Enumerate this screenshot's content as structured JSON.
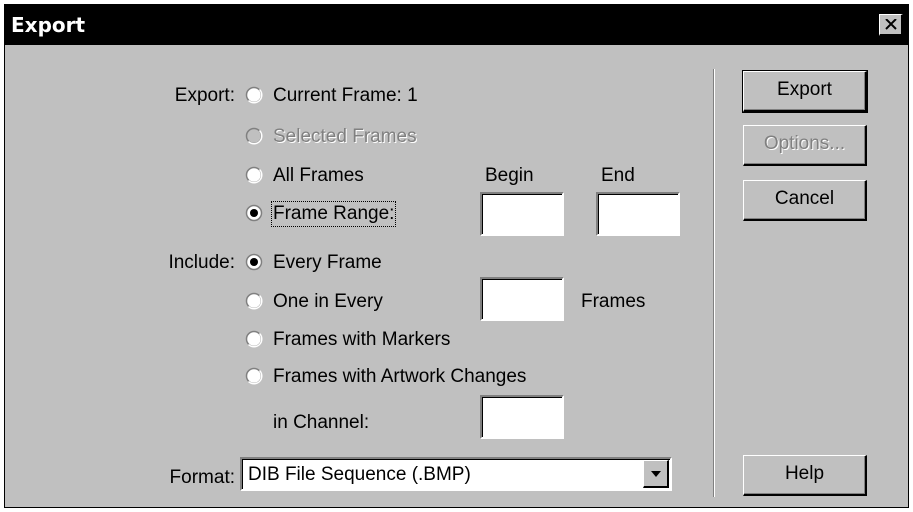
{
  "window": {
    "title": "Export"
  },
  "export_group": {
    "label": "Export:",
    "options": [
      {
        "label": "Current Frame: 1",
        "selected": false,
        "enabled": true
      },
      {
        "label": "Selected Frames",
        "selected": false,
        "enabled": false
      },
      {
        "label": "All Frames",
        "selected": false,
        "enabled": true
      },
      {
        "label": "Frame Range:",
        "selected": true,
        "enabled": true
      }
    ],
    "begin_label": "Begin",
    "end_label": "End",
    "begin_value": "",
    "end_value": ""
  },
  "include_group": {
    "label": "Include:",
    "options": [
      {
        "label": "Every Frame",
        "selected": true
      },
      {
        "label": "One in Every",
        "selected": false
      },
      {
        "label": "Frames with Markers",
        "selected": false
      },
      {
        "label": "Frames with Artwork Changes",
        "selected": false
      }
    ],
    "one_in_every_value": "",
    "frames_label": "Frames",
    "channel_label": "in Channel:",
    "channel_value": ""
  },
  "format": {
    "label": "Format:",
    "selected": "DIB File Sequence (.BMP)"
  },
  "buttons": {
    "export": "Export",
    "options": "Options...",
    "cancel": "Cancel",
    "help": "Help"
  },
  "colors": {
    "dialog_bg": "#c0c0c0",
    "titlebar_bg": "#000000",
    "disabled_text": "#808080"
  }
}
